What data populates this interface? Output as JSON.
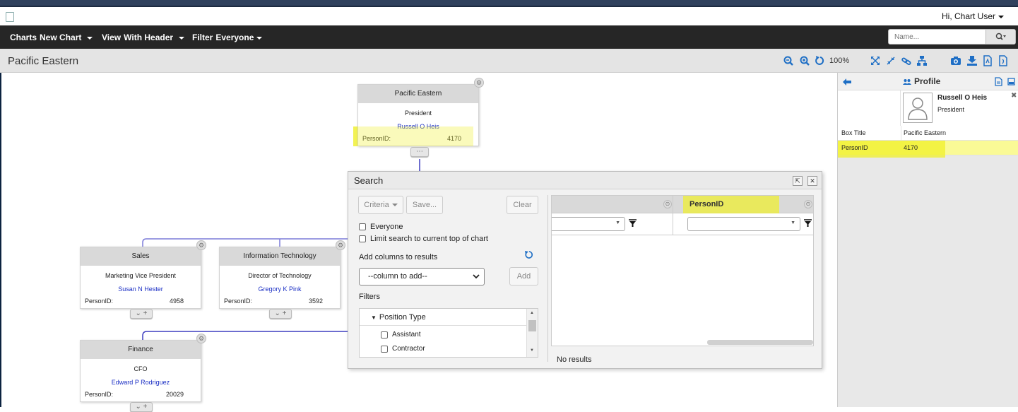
{
  "user": {
    "greeting": "Hi, Chart User"
  },
  "nav": {
    "charts_label": "Charts",
    "charts_value": "New Chart",
    "view_label": "View",
    "view_value": "With Header",
    "filter_label": "Filter",
    "filter_value": "Everyone",
    "search_placeholder": "Name..."
  },
  "title": {
    "chart_name": "Pacific Eastern",
    "zoom": "100%"
  },
  "boxes": {
    "top": {
      "head": "Pacific Eastern",
      "title": "President",
      "name": "Russell O Heis",
      "id_label": "PersonID:",
      "id": "4170"
    },
    "sales": {
      "head": "Sales",
      "title": "Marketing Vice President",
      "name": "Susan N Hester",
      "id_label": "PersonID:",
      "id": "4958"
    },
    "it": {
      "head": "Information Technology",
      "title": "Director of Technology",
      "name": "Gregory K Pink",
      "id_label": "PersonID:",
      "id": "3592"
    },
    "finance": {
      "head": "Finance",
      "title": "CFO",
      "name": "Edward P Rodriguez",
      "id_label": "PersonID:",
      "id": "20029"
    }
  },
  "search": {
    "title": "Search",
    "criteria": "Criteria",
    "save": "Save...",
    "clear": "Clear",
    "everyone": "Everyone",
    "limit": "Limit search to current top of chart",
    "add_columns": "Add columns to results",
    "column_placeholder": "--column to add--",
    "add": "Add",
    "filters": "Filters",
    "position_type": "Position Type",
    "opt_assistant": "Assistant",
    "opt_contractor": "Contractor",
    "col_personid": "PersonID",
    "no_results": "No results"
  },
  "profile": {
    "title": "Profile",
    "name": "Russell O Heis",
    "position": "President",
    "box_title_label": "Box Title",
    "box_title_value": "Pacific Eastern",
    "personid_label": "PersonID",
    "personid_value": "4170"
  },
  "colors": {
    "accent": "#1f6fc5",
    "highlight": "#f0f028",
    "nav": "#262626",
    "link": "#1a2ec4"
  }
}
